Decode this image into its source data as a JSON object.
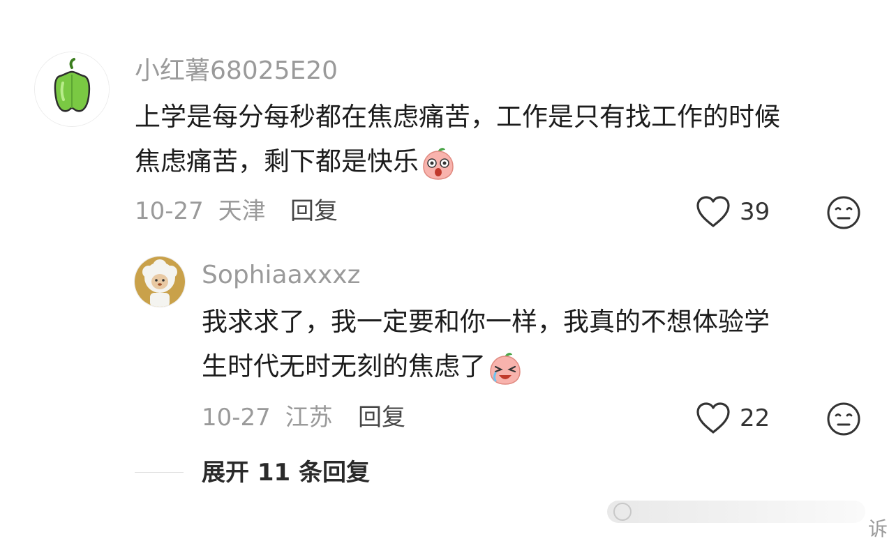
{
  "comment": {
    "username": "小红薯68025E20",
    "content_lines": [
      "上学是每分每秒都在焦虑痛苦，工作是只有找工作的时候",
      "焦虑痛苦，剩下都是快乐"
    ],
    "date": "10-27",
    "location": "天津",
    "reply_label": "回复",
    "like_count": "39",
    "avatar_icon": "green-pepper-avatar-icon",
    "emoji_icon": "surprised-peach-emoji-icon",
    "dislike_icon": "neutral-face-icon"
  },
  "reply": {
    "username": "Sophiaaxxxz",
    "content_lines": [
      "我求求了，我一定要和你一样，我真的不想体验学",
      "生时代无时无刻的焦虑了"
    ],
    "date": "10-27",
    "location": "江苏",
    "reply_label": "回复",
    "like_count": "22",
    "avatar_icon": "sheep-avatar-icon",
    "emoji_icon": "crying-peach-emoji-icon",
    "dislike_icon": "neutral-face-icon"
  },
  "expand": {
    "label": "展开 11 条回复"
  },
  "watermark": {
    "text": "诉"
  },
  "colors": {
    "pepper_green": "#7ac943",
    "peach_pink": "#f8b3ad",
    "text_gray": "#9a9a9a"
  }
}
